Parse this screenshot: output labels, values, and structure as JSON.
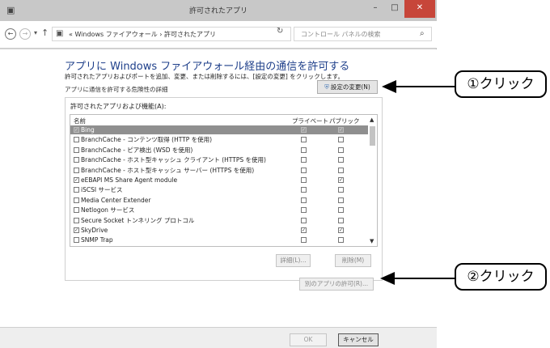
{
  "window": {
    "title": "許可されたアプリ",
    "minimize_glyph": "–",
    "maximize_glyph": "□",
    "close_glyph": "✕"
  },
  "nav": {
    "back_glyph": "←",
    "forward_glyph": "→",
    "history_glyph": "▾",
    "up_glyph": "↑",
    "address_text": "« Windows ファイアウォール  ›  許可されたアプリ",
    "address_dropdown_glyph": "▾",
    "refresh_glyph": "↻",
    "search_placeholder": "コントロール パネルの検索"
  },
  "main": {
    "heading": "アプリに Windows ファイアウォール経由の通信を許可する",
    "description": "許可されたアプリおよびポートを追加、変更、または削除するには、[設定の変更] をクリックします。",
    "risk_link": "アプリに通信を許可する危険性の詳細",
    "change_settings_label": "設定の変更(N)"
  },
  "apps_group": {
    "label": "許可されたアプリおよび機能(A):",
    "columns": {
      "name": "名前",
      "private": "プライベート",
      "public": "パブリック"
    },
    "rows": [
      {
        "name": "Bing",
        "checked": true,
        "private": true,
        "public": true,
        "selected": true
      },
      {
        "name": "BranchCache - コンテンツ取得 (HTTP を使用)",
        "checked": false,
        "private": false,
        "public": false
      },
      {
        "name": "BranchCache - ピア検出 (WSD を使用)",
        "checked": false,
        "private": false,
        "public": false
      },
      {
        "name": "BranchCache - ホスト型キャッシュ クライアント (HTTPS を使用)",
        "checked": false,
        "private": false,
        "public": false
      },
      {
        "name": "BranchCache - ホスト型キャッシュ サーバー (HTTPS を使用)",
        "checked": false,
        "private": false,
        "public": false
      },
      {
        "name": "eEBAPI MS Share Agent module",
        "checked": true,
        "private": false,
        "public": true
      },
      {
        "name": "iSCSI サービス",
        "checked": false,
        "private": false,
        "public": false
      },
      {
        "name": "Media Center Extender",
        "checked": false,
        "private": false,
        "public": false
      },
      {
        "name": "Netlogon サービス",
        "checked": false,
        "private": false,
        "public": false
      },
      {
        "name": "Secure Socket トンネリング プロトコル",
        "checked": false,
        "private": false,
        "public": false
      },
      {
        "name": "SkyDrive",
        "checked": true,
        "private": true,
        "public": true
      },
      {
        "name": "SNMP Trap",
        "checked": false,
        "private": false,
        "public": false
      }
    ],
    "details_label": "詳細(L)...",
    "remove_label": "削除(M)",
    "scroll_up_glyph": "▲",
    "scroll_down_glyph": "▼"
  },
  "other_app_label": "別のアプリの許可(R)...",
  "footer": {
    "ok_label": "OK",
    "cancel_label": "キャンセル"
  },
  "annotations": {
    "callout_1": "①クリック",
    "callout_2": "②クリック"
  }
}
